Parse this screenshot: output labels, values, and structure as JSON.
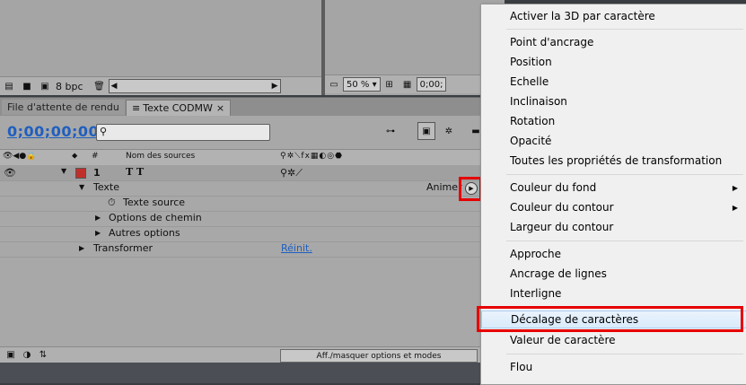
{
  "left_panel": {
    "bpc_label": "8 bpc"
  },
  "right_panel": {
    "zoom": "50 %",
    "timecode_partial": "0;00;"
  },
  "tabs": [
    {
      "label": "File d'attente de rendu",
      "active": false
    },
    {
      "label": "Texte CODMW",
      "active": true,
      "close": "×"
    }
  ],
  "timeline": {
    "timecode": "0;00;00;00",
    "search_placeholder": "",
    "columns": {
      "num": "#",
      "source": "Nom des sources"
    },
    "layer": {
      "index": "1",
      "name": "T T",
      "label_color": "#c0302a"
    },
    "rows": [
      {
        "label": "Texte",
        "right": "Animer :"
      },
      {
        "label": "Texte source"
      },
      {
        "label": "Options de chemin"
      },
      {
        "label": "Autres options"
      },
      {
        "label": "Transformer",
        "right": "Réinit."
      }
    ],
    "toggle_button": "Aff./masquer options et modes"
  },
  "context_menu": {
    "items": [
      {
        "label": "Activer la 3D par caractère"
      },
      {
        "label": "Point d'ancrage"
      },
      {
        "label": "Position"
      },
      {
        "label": "Echelle"
      },
      {
        "label": "Inclinaison"
      },
      {
        "label": "Rotation"
      },
      {
        "label": "Opacité"
      },
      {
        "label": "Toutes les propriétés de transformation"
      },
      {
        "label": "Couleur du fond",
        "submenu": "▶"
      },
      {
        "label": "Couleur du contour",
        "submenu": "▶"
      },
      {
        "label": "Largeur du contour"
      },
      {
        "label": "Approche"
      },
      {
        "label": "Ancrage de lignes"
      },
      {
        "label": "Interligne"
      },
      {
        "label": "Décalage de caractères",
        "highlighted": true
      },
      {
        "label": "Valeur de caractère"
      },
      {
        "label": "Flou"
      }
    ]
  },
  "colors": {
    "accent_red": "#e60000",
    "timecode_blue": "#1f5fbf",
    "menu_highlight": "#d9ebfb"
  }
}
